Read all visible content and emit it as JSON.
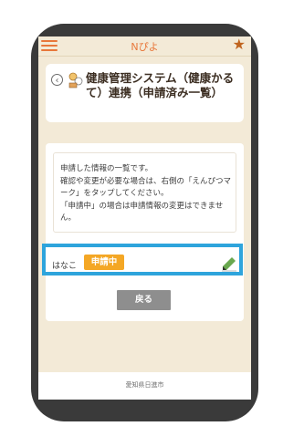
{
  "header": {
    "app_title": "Nぴよ"
  },
  "page": {
    "title": "健康管理システム（健康かるて）連携（申請済み一覧）"
  },
  "info": {
    "text": "申請した情報の一覧です。\n確認や変更が必要な場合は、右側の「えんぴつマーク」をタップしてください。\n「申請中」の場合は申請情報の変更はできません。"
  },
  "entry": {
    "name": "はなこ",
    "status": "申請中"
  },
  "actions": {
    "back_label": "戻る"
  },
  "footer": {
    "text": "愛知県日進市"
  },
  "colors": {
    "accent": "#e8773a",
    "status_badge": "#f4a725",
    "highlight": "#2ea4dc",
    "back_button": "#8e8e8e"
  },
  "icons": {
    "menu": "hamburger-icon",
    "favorite": "star-icon",
    "back": "back-circle-icon",
    "edit": "pencil-icon"
  }
}
